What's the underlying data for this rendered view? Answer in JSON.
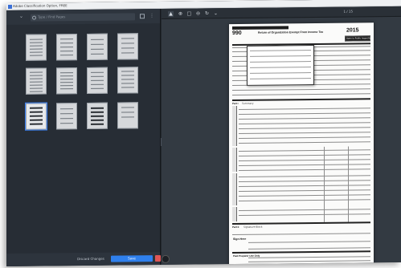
{
  "window": {
    "title": "Adobe Classification Option, FREE"
  },
  "left_panel": {
    "search_placeholder": "Type / Find Pages",
    "discard_label": "Discard Changes",
    "save_label": "Save"
  },
  "viewer": {
    "page_indicator": "1 / 15"
  },
  "form": {
    "form_number": "990",
    "form_title": "Return of Organization Exempt From Income Tax",
    "year": "2015",
    "open_label": "Open to Public Inspection",
    "part_i": "Part I",
    "summary": "Summary",
    "part_ii": "Part II",
    "signature_block": "Signature Block",
    "sign_here": "Sign Here",
    "paid_preparer": "Paid Preparer Use Only",
    "activities": "Activities & Governance",
    "revenue": "Revenue",
    "expenses": "Expenses",
    "net_assets": "Net Assets or Fund Balances"
  },
  "colors": {
    "accent": "#2f80ed",
    "panel": "#272d35",
    "danger": "#e05555"
  }
}
